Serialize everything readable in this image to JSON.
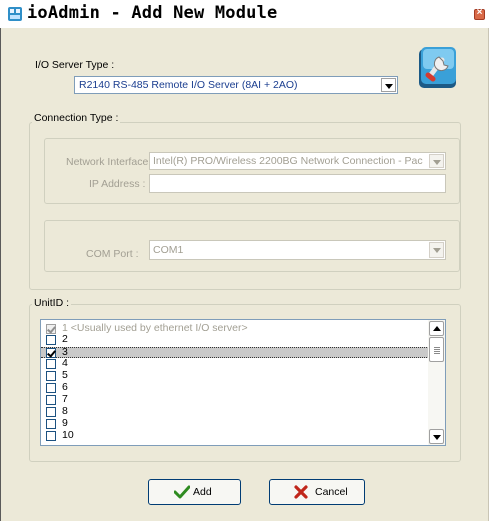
{
  "window": {
    "title": "ioAdmin - Add New Module",
    "close_symbol": "×",
    "accent": "#316ac5"
  },
  "server": {
    "label": "I/O Server Type :",
    "value": "R2140  RS-485 Remote I/O Server (8AI + 2AO)"
  },
  "connection": {
    "group_label": "Connection Type :",
    "network_interface_label": "Network Interface :",
    "network_interface_value": "Intel(R) PRO/Wireless 2200BG Network Connection - Pac",
    "ip_address_label": "IP Address :",
    "ip_address_value": "",
    "com_port_label": "COM Port :",
    "com_port_value": "COM1"
  },
  "unit": {
    "group_label": "UnitID :",
    "items": [
      {
        "label": "1 <Usually used by ethernet I/O server>",
        "checked": true,
        "disabled": true
      },
      {
        "label": "2",
        "checked": false
      },
      {
        "label": "3",
        "checked": true,
        "selected": true
      },
      {
        "label": "4",
        "checked": false
      },
      {
        "label": "5",
        "checked": false
      },
      {
        "label": "6",
        "checked": false
      },
      {
        "label": "7",
        "checked": false
      },
      {
        "label": "8",
        "checked": false
      },
      {
        "label": "9",
        "checked": false
      },
      {
        "label": "10",
        "checked": false
      }
    ]
  },
  "buttons": {
    "add_label": "Add",
    "cancel_label": "Cancel"
  },
  "icons": {
    "app": "app-icon",
    "settings": "settings-wrench-icon",
    "add": "checkmark-icon",
    "cancel": "x-icon"
  }
}
